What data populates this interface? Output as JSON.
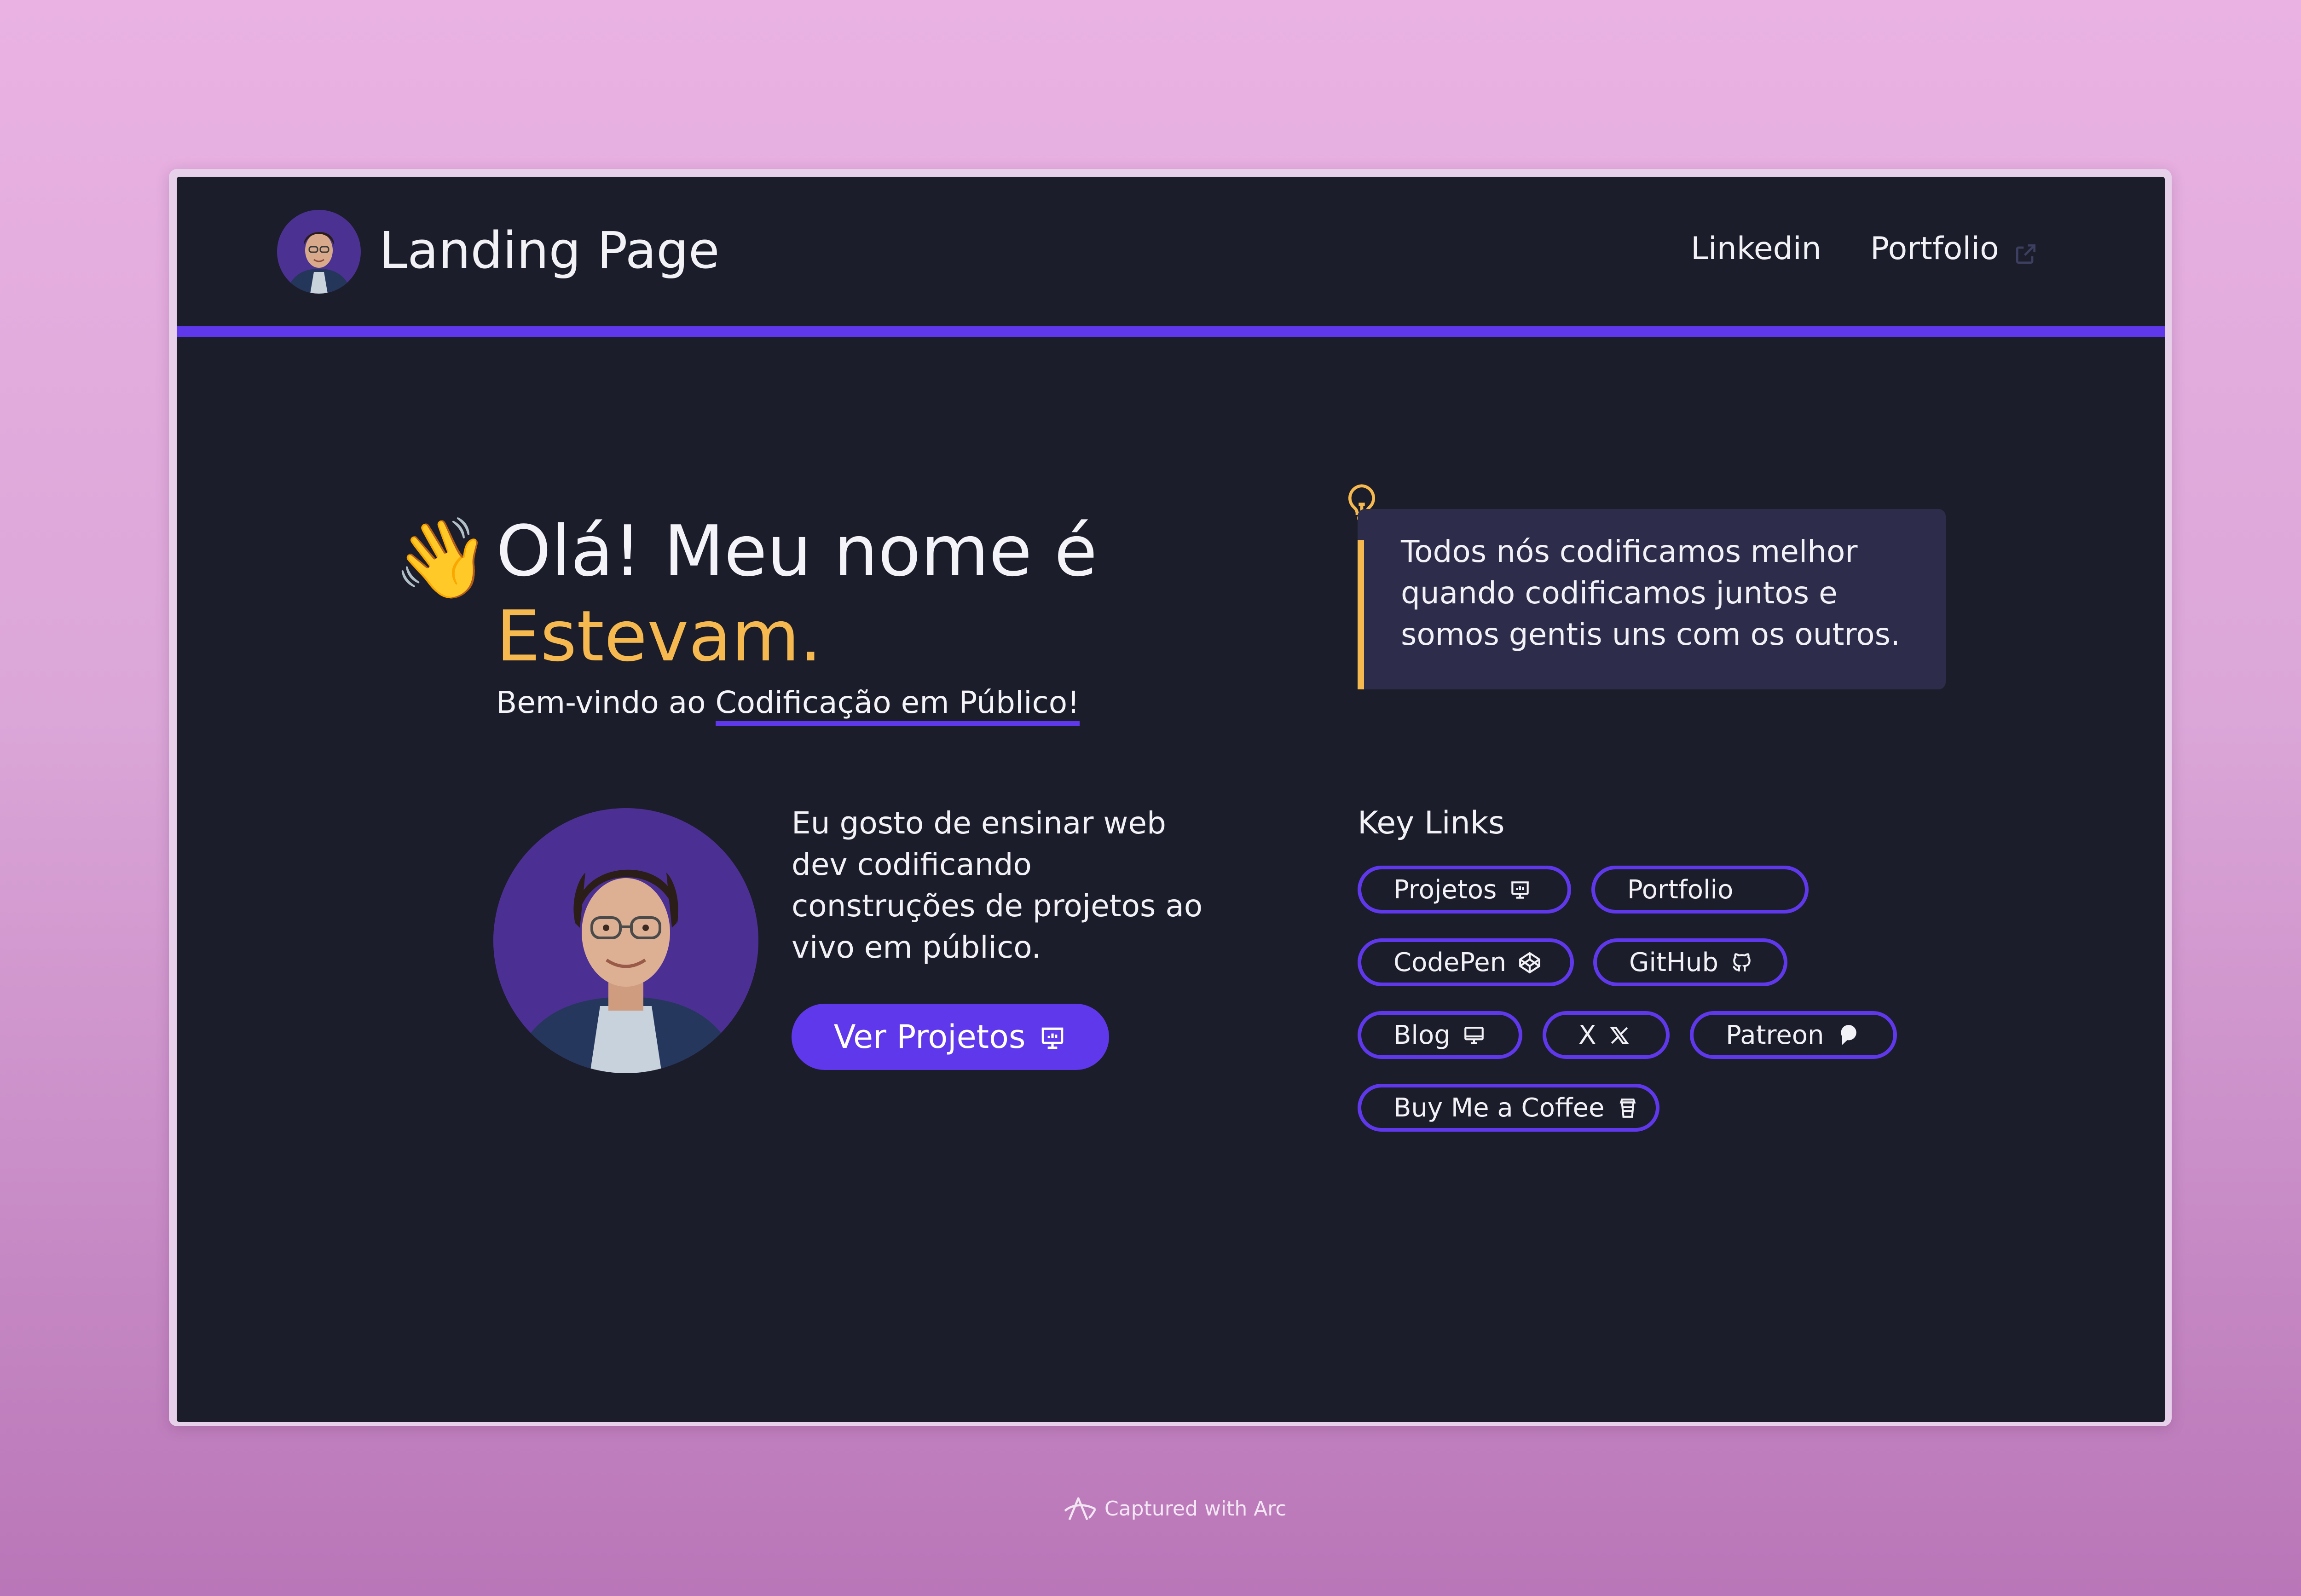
{
  "header": {
    "title": "Landing Page",
    "nav": {
      "linkedin": "Linkedin",
      "portfolio": "Portfolio"
    }
  },
  "hero": {
    "title": "Olá! Meu nome é",
    "name": "Estevam.",
    "welcome_prefix": "Bem-vindo ao ",
    "welcome_highlight": "Codificação em Público!",
    "about": "Eu gosto de ensinar web dev codificando construções de projetos ao vivo em público.",
    "cta_label": "Ver Projetos"
  },
  "quote": {
    "text": "Todos nós codificamos melhor quando codificamos juntos e somos gentis uns com os outros."
  },
  "key_links": {
    "title": "Key Links",
    "items": [
      {
        "label": "Projetos",
        "icon": "presentation-chart-icon"
      },
      {
        "label": "Portfolio",
        "icon": ""
      },
      {
        "label": "CodePen",
        "icon": "codepen-icon"
      },
      {
        "label": "GitHub",
        "icon": "github-icon"
      },
      {
        "label": "Blog",
        "icon": "monitor-icon"
      },
      {
        "label": "X",
        "icon": "x-logo-icon"
      },
      {
        "label": "Patreon",
        "icon": "patreon-icon"
      },
      {
        "label": "Buy Me a Coffee",
        "icon": "coffee-cup-icon"
      }
    ]
  },
  "footer": {
    "captured": "Captured with Arc"
  },
  "colors": {
    "background_dark": "#1c1d2b",
    "accent_purple": "#5f38eb",
    "accent_yellow": "#f6b94f",
    "quote_bg": "#2d2c4a"
  }
}
